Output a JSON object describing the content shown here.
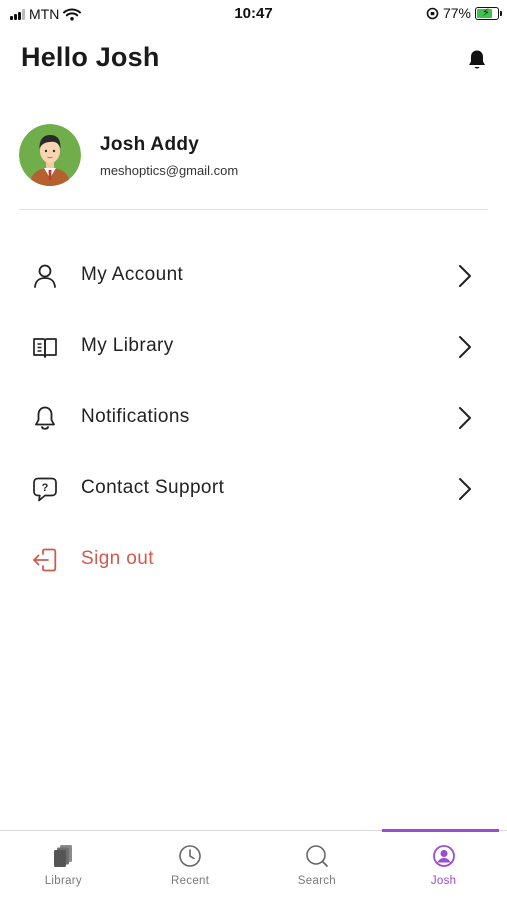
{
  "status_bar": {
    "carrier": "MTN",
    "time": "10:47",
    "battery": "77%",
    "battery_level": 0.77
  },
  "header": {
    "title": "Hello Josh"
  },
  "profile": {
    "name": "Josh Addy",
    "email": "meshoptics@gmail.com"
  },
  "menu": {
    "items": [
      {
        "label": "My Account",
        "icon": "user-icon"
      },
      {
        "label": "My Library",
        "icon": "book-icon"
      },
      {
        "label": "Notifications",
        "icon": "bell-icon"
      },
      {
        "label": "Contact Support",
        "icon": "help-chat-icon"
      }
    ],
    "sign_out": {
      "label": "Sign out",
      "icon": "sign-out-icon"
    }
  },
  "tabbar": {
    "tabs": [
      {
        "label": "Library",
        "icon": "library-icon"
      },
      {
        "label": "Recent",
        "icon": "clock-icon"
      },
      {
        "label": "Search",
        "icon": "search-icon"
      },
      {
        "label": "Josh",
        "icon": "profile-icon",
        "active": true
      }
    ]
  },
  "colors": {
    "accent": "#9b4dd1",
    "danger": "#d15a4e",
    "battery": "#3dc24a"
  }
}
